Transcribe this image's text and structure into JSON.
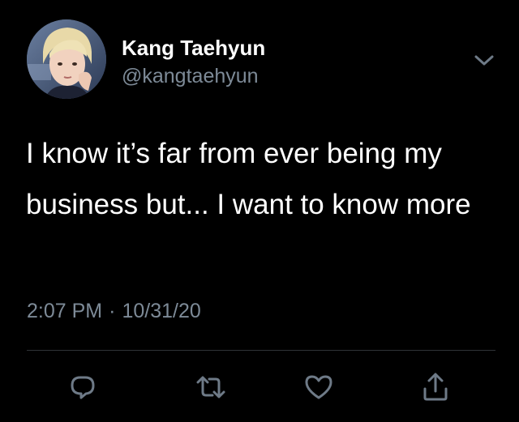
{
  "user": {
    "display_name": "Kang Taehyun",
    "handle": "@kangtaehyun"
  },
  "tweet": {
    "text": "I know it’s far from ever being my business but... I want to know more",
    "time": "2:07 PM",
    "separator": "·",
    "date": "10/31/20"
  },
  "icons": {
    "menu": "chevron-down-icon",
    "reply": "reply-icon",
    "retweet": "retweet-icon",
    "like": "heart-icon",
    "share": "share-icon"
  },
  "colors": {
    "background": "#000000",
    "text_primary": "#ffffff",
    "text_secondary": "#7d8a97",
    "divider": "#2f3336",
    "icon": "#6e7a87"
  }
}
